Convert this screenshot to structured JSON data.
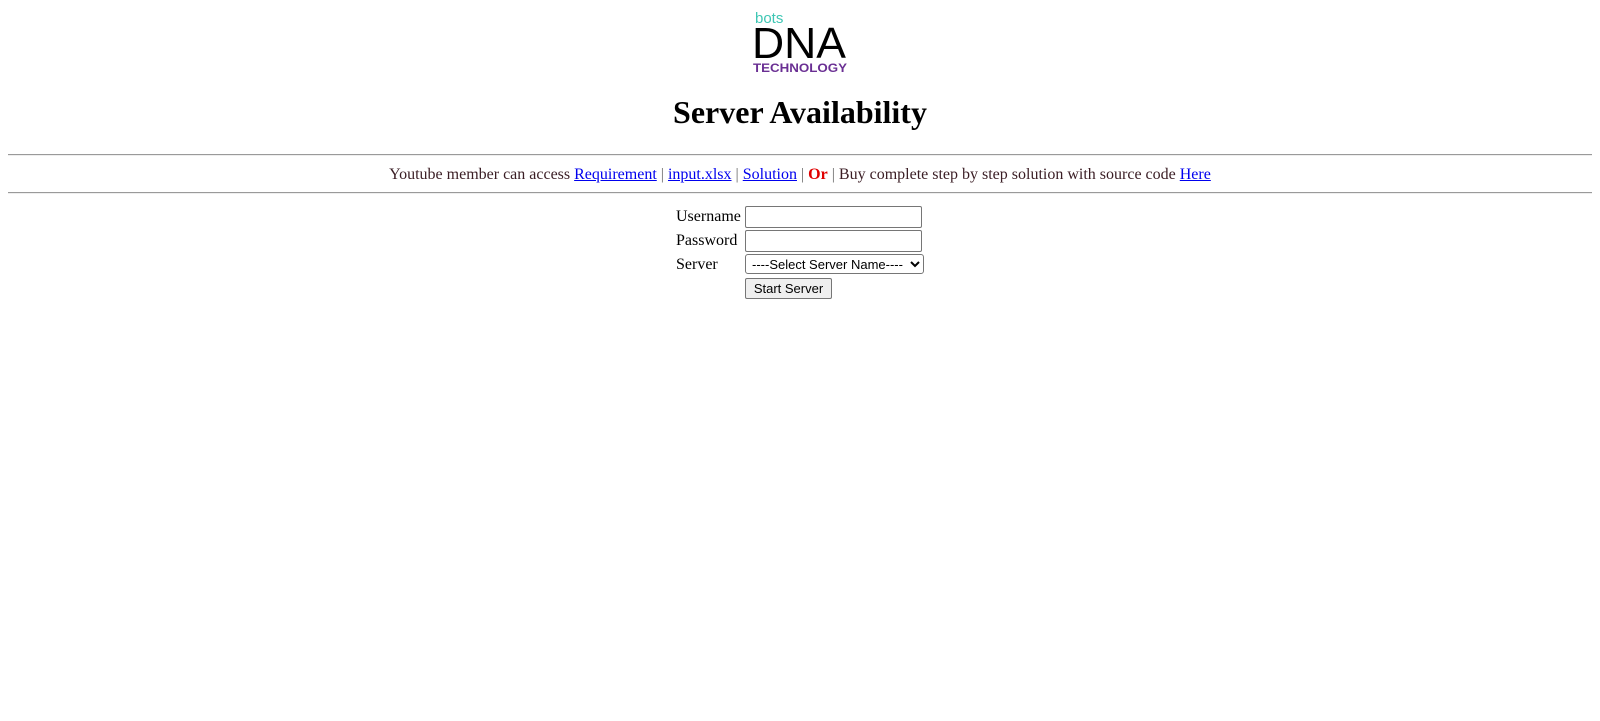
{
  "logo": {
    "top_text": "bots",
    "main_text": "DNA",
    "bottom_text": "TECHNOLOGY",
    "colors": {
      "top": "#3ec6b4",
      "main": "#000000",
      "bottom": "#6a2f93"
    }
  },
  "page": {
    "title": "Server Availability"
  },
  "notice": {
    "prefix": "Youtube member can access",
    "links": {
      "requirement": "Requirement",
      "input_file": "input.xlsx",
      "solution": "Solution",
      "here": "Here"
    },
    "separator": "|",
    "or_text": "Or",
    "buy_text": "Buy complete step by step solution with source code",
    "colors": {
      "text": "#3a1d24",
      "link": "#0000ee",
      "or": "#e00000"
    }
  },
  "form": {
    "username_label": "Username",
    "username_value": "",
    "password_label": "Password",
    "password_value": "",
    "server_label": "Server",
    "server_selected": "----Select Server Name----",
    "submit_label": "Start Server"
  }
}
